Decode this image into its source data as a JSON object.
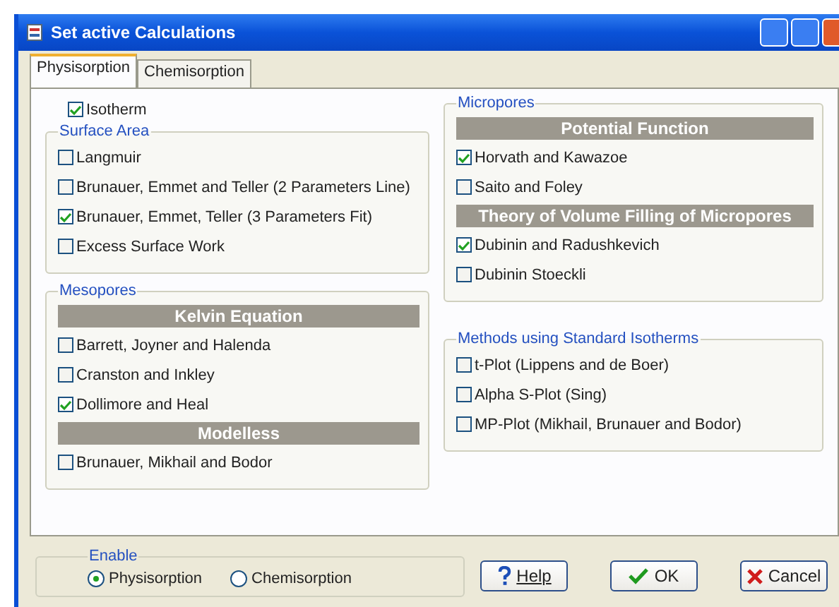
{
  "window": {
    "title": "Set active Calculations"
  },
  "tabs": [
    {
      "label": "Physisorption",
      "selected": true
    },
    {
      "label": "Chemisorption",
      "selected": false
    }
  ],
  "isotherm": {
    "label": "Isotherm",
    "checked": true
  },
  "columns": [
    [
      {
        "title": "Surface Area",
        "items": [
          {
            "kind": "checkbox",
            "label": "Langmuir",
            "checked": false
          },
          {
            "kind": "checkbox",
            "label": "Brunauer, Emmet and Teller (2 Parameters Line)",
            "checked": false
          },
          {
            "kind": "checkbox",
            "label": "Brunauer, Emmet, Teller (3 Parameters Fit)",
            "checked": true
          },
          {
            "kind": "checkbox",
            "label": "Excess Surface Work",
            "checked": false
          }
        ]
      },
      {
        "title": "Mesopores",
        "items": [
          {
            "kind": "header",
            "label": "Kelvin Equation"
          },
          {
            "kind": "checkbox",
            "label": "Barrett, Joyner and Halenda",
            "checked": false
          },
          {
            "kind": "checkbox",
            "label": "Cranston and Inkley",
            "checked": false
          },
          {
            "kind": "checkbox",
            "label": "Dollimore and Heal",
            "checked": true
          },
          {
            "kind": "header",
            "label": "Modelless"
          },
          {
            "kind": "checkbox",
            "label": "Brunauer, Mikhail and Bodor",
            "checked": false
          }
        ]
      }
    ],
    [
      {
        "title": "Micropores",
        "items": [
          {
            "kind": "header",
            "label": "Potential Function"
          },
          {
            "kind": "checkbox",
            "label": "Horvath and Kawazoe",
            "checked": true
          },
          {
            "kind": "checkbox",
            "label": "Saito and Foley",
            "checked": false
          },
          {
            "kind": "header",
            "label": "Theory of Volume Filling of Micropores"
          },
          {
            "kind": "checkbox",
            "label": "Dubinin and Radushkevich",
            "checked": true
          },
          {
            "kind": "checkbox",
            "label": "Dubinin Stoeckli",
            "checked": false
          }
        ]
      },
      {
        "title": "Methods using Standard Isotherms",
        "items": [
          {
            "kind": "checkbox",
            "label": "t-Plot (Lippens and de Boer)",
            "checked": false
          },
          {
            "kind": "checkbox",
            "label": "Alpha S-Plot (Sing)",
            "checked": false
          },
          {
            "kind": "checkbox",
            "label": "MP-Plot (Mikhail, Brunauer and Bodor)",
            "checked": false
          }
        ]
      }
    ]
  ],
  "enable": {
    "title": "Enable",
    "options": [
      {
        "label": "Physisorption",
        "selected": true
      },
      {
        "label": "Chemisorption",
        "selected": false
      }
    ]
  },
  "buttons": [
    {
      "kind": "help",
      "label": "Help"
    },
    {
      "kind": "ok",
      "label": "OK"
    },
    {
      "kind": "cancel",
      "label": "Cancel"
    }
  ]
}
